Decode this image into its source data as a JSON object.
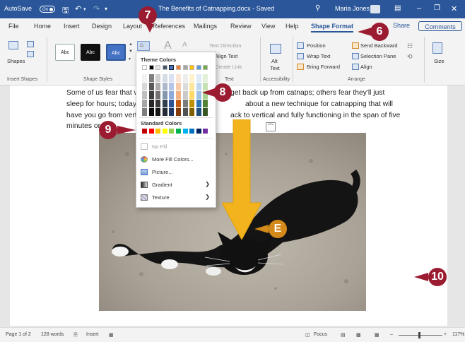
{
  "titlebar": {
    "autosave_label": "AutoSave",
    "autosave_state": "On",
    "document_title": "The Benefits of Catnapping.docx - Saved",
    "user_name": "Maria Jones"
  },
  "tabs": [
    {
      "label": "File"
    },
    {
      "label": "Home"
    },
    {
      "label": "Insert"
    },
    {
      "label": "Design"
    },
    {
      "label": "Layout"
    },
    {
      "label": "References"
    },
    {
      "label": "Mailings"
    },
    {
      "label": "Review"
    },
    {
      "label": "View"
    },
    {
      "label": "Help"
    },
    {
      "label": "Shape Format"
    }
  ],
  "share_label": "Share",
  "comments_label": "Comments",
  "ribbon": {
    "insert_shapes": {
      "shapes_label": "Shapes",
      "group_label": "Insert Shapes"
    },
    "shape_styles": {
      "style_labels": [
        "Abc",
        "Abc",
        "Abc"
      ],
      "group_label": "Shape Styles"
    },
    "text": {
      "text_direction": "Text Direction",
      "align_text": "Align Text",
      "create_link": "Create Link",
      "group_label": "Text"
    },
    "accessibility": {
      "alt_text_1": "Alt",
      "alt_text_2": "Text",
      "group_label": "Accessibility"
    },
    "arrange": {
      "position": "Position",
      "wrap_text": "Wrap Text",
      "bring_forward": "Bring Forward",
      "send_backward": "Send Backward",
      "selection_pane": "Selection Pane",
      "align": "Align",
      "group_label": "Arrange"
    },
    "size_label": "Size"
  },
  "fill_menu": {
    "theme_colors_label": "Theme Colors",
    "standard_colors_label": "Standard Colors",
    "theme_top_row": [
      "#ffffff",
      "#000000",
      "#e7e6e6",
      "#44546a",
      "#4472c4",
      "#ed7d31",
      "#a5a5a5",
      "#ffc000",
      "#5b9bd5",
      "#70ad47"
    ],
    "theme_shades": [
      [
        "#f2f2f2",
        "#7f7f7f",
        "#d0cece",
        "#d6dce4",
        "#d9e2f3",
        "#fbe5d5",
        "#ededed",
        "#fff2cc",
        "#deebf6",
        "#e2efd9"
      ],
      [
        "#d8d8d8",
        "#595959",
        "#aeabab",
        "#adb9ca",
        "#b4c6e7",
        "#f7cbac",
        "#dbdbdb",
        "#fee599",
        "#bdd7ee",
        "#c5e0b3"
      ],
      [
        "#bfbfbf",
        "#3f3f3f",
        "#757070",
        "#8496b0",
        "#8eaadb",
        "#f4b183",
        "#c9c9c9",
        "#ffd965",
        "#9cc3e5",
        "#a8d08d"
      ],
      [
        "#a5a5a5",
        "#262626",
        "#3a3838",
        "#323f4f",
        "#2f5496",
        "#c55a11",
        "#7b7b7b",
        "#bf9000",
        "#2e75b5",
        "#538135"
      ],
      [
        "#7f7f7f",
        "#0c0c0c",
        "#171616",
        "#222a35",
        "#1f3864",
        "#833c0b",
        "#525252",
        "#7f6000",
        "#1e4e79",
        "#375623"
      ]
    ],
    "standard_colors": [
      "#c00000",
      "#ff0000",
      "#ffc000",
      "#ffff00",
      "#92d050",
      "#00b050",
      "#00b0f0",
      "#0070c0",
      "#002060",
      "#7030a0"
    ],
    "items": [
      {
        "label": "No Fill",
        "icon": "no-fill-icon",
        "has_submenu": false
      },
      {
        "label": "More Fill Colors...",
        "icon": "palette-icon",
        "has_submenu": false
      },
      {
        "label": "Picture...",
        "icon": "picture-icon",
        "has_submenu": false
      },
      {
        "label": "Gradient",
        "icon": "gradient-icon",
        "has_submenu": true
      },
      {
        "label": "Texture",
        "icon": "texture-icon",
        "has_submenu": true
      }
    ]
  },
  "document": {
    "paragraph_lines": [
      "Some of us fear that w",
      "sleep for hours; today",
      "have you go from vert",
      "minutes or"
    ],
    "paragraph_lines_right": [
      "get back up from catnaps; others fear they'll just",
      "about a new technique for catnapping that will",
      "ack to vertical and fully functioning in the span of five",
      ""
    ]
  },
  "callouts": [
    "7",
    "6",
    "8",
    "9",
    "E",
    "10"
  ],
  "colors": {
    "accent": "#2b579a",
    "callout": "#9b1c31",
    "arrow": "#f2b31c"
  },
  "statusbar": {
    "page": "Page 1 of 2",
    "words": "128 words",
    "mode": "Insert",
    "focus": "Focus",
    "zoom": "117%"
  }
}
